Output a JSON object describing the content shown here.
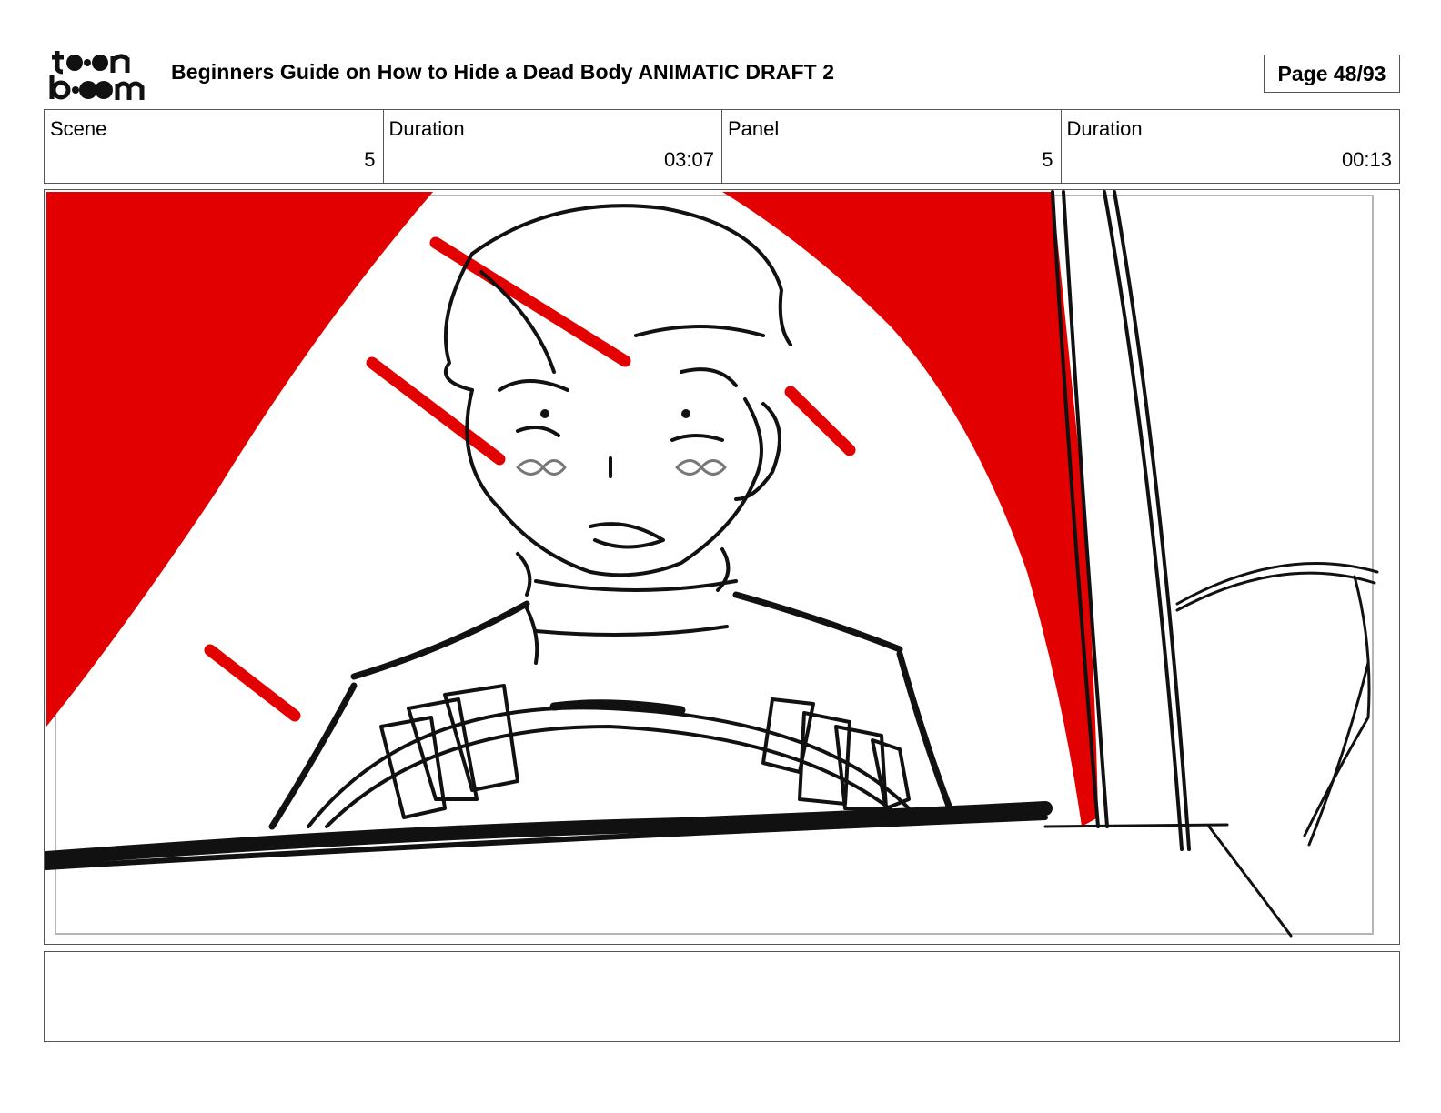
{
  "header": {
    "logo_text": "toon boom",
    "title": "Beginners Guide on How to Hide a Dead Body ANIMATIC DRAFT 2",
    "page": "Page 48/93"
  },
  "info": {
    "scene_label": "Scene",
    "scene_value": "5",
    "scene_duration_label": "Duration",
    "scene_duration_value": "03:07",
    "panel_label": "Panel",
    "panel_value": "5",
    "panel_duration_label": "Duration",
    "panel_duration_value": "00:13"
  },
  "notes": {
    "text": ""
  },
  "colors": {
    "accent_red": "#e30000",
    "border": "#555555"
  }
}
